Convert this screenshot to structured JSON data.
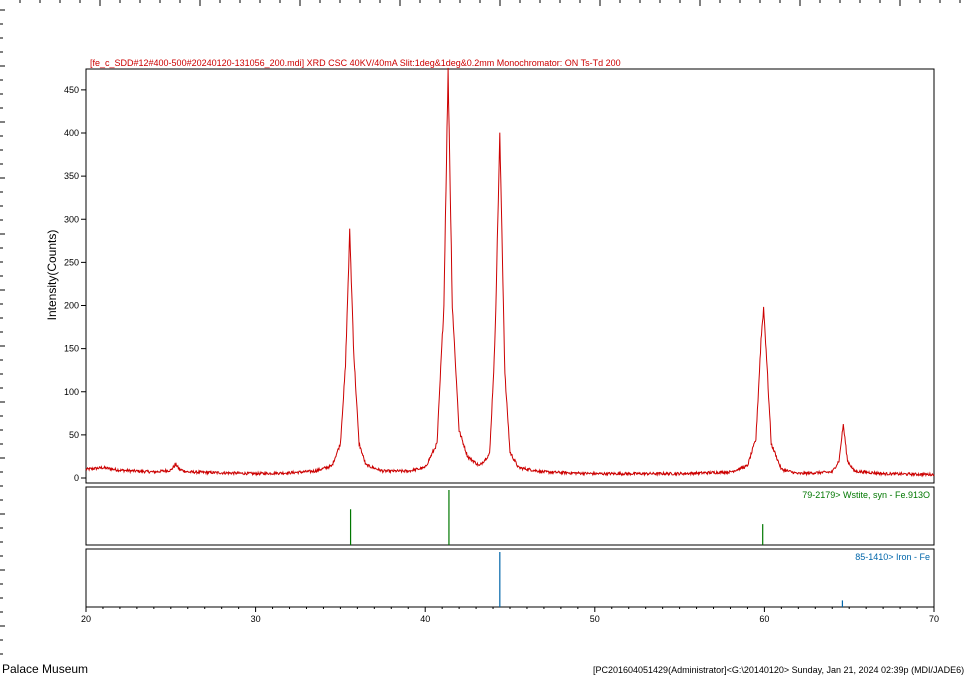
{
  "chart_data": {
    "type": "line",
    "title": "[fe_c_SDD#12#400-500#20240120-131056_200.mdi] XRD CSC 40KV/40mA Slit:1deg&1deg&0.2mm Monochromator: ON Ts-Td 200",
    "xlabel": "",
    "ylabel": "Intensity(Counts)",
    "xlim": [
      20,
      70
    ],
    "ylim": [
      0,
      480
    ],
    "x_ticks": [
      20,
      30,
      40,
      50,
      60,
      70
    ],
    "y_ticks": [
      0,
      50,
      100,
      150,
      200,
      250,
      300,
      350,
      400,
      450
    ],
    "grid": false,
    "colors": {
      "pattern": "#cc0000",
      "wustite": "#007700",
      "iron": "#0066aa"
    },
    "series": [
      {
        "x": [
          20.0,
          21.0,
          22.0,
          23.0,
          24.0,
          25.0,
          25.3,
          25.5,
          26.0,
          28.0,
          30.0,
          32.0,
          33.5,
          34.5,
          35.0,
          35.3,
          35.55,
          35.8,
          36.1,
          36.5,
          37.5,
          39.0,
          40.0,
          40.7,
          41.1,
          41.35,
          41.6,
          42.0,
          42.5,
          43.2,
          43.8,
          44.1,
          44.4,
          44.7,
          45.0,
          45.5,
          47.0,
          50.0,
          55.0,
          58.0,
          59.0,
          59.5,
          59.8,
          59.95,
          60.1,
          60.4,
          61.0,
          62.0,
          64.0,
          64.4,
          64.65,
          64.9,
          65.3,
          67.0,
          70.0
        ],
        "y": [
          10,
          12,
          9,
          8,
          7,
          9,
          16,
          10,
          7,
          6,
          5,
          6,
          8,
          14,
          40,
          130,
          285,
          140,
          40,
          15,
          8,
          8,
          12,
          40,
          200,
          472,
          200,
          55,
          25,
          14,
          28,
          150,
          397,
          120,
          30,
          12,
          7,
          5,
          5,
          7,
          14,
          45,
          160,
          197,
          150,
          40,
          10,
          5,
          7,
          20,
          62,
          20,
          8,
          5,
          4
        ]
      }
    ],
    "reference_patterns": [
      {
        "label": "79-2179> Wstite, syn - Fe.913O",
        "lines": [
          {
            "x": 35.6,
            "intensity": 0.65
          },
          {
            "x": 41.4,
            "intensity": 1.0
          },
          {
            "x": 59.9,
            "intensity": 0.38
          }
        ]
      },
      {
        "label": "85-1410> Iron - Fe",
        "lines": [
          {
            "x": 44.4,
            "intensity": 1.0
          },
          {
            "x": 64.6,
            "intensity": 0.12
          }
        ]
      }
    ]
  },
  "footer": {
    "left": "Palace Museum",
    "right": "[PC201604051429(Administrator]<G:\\20140120> Sunday, Jan 21, 2024 02:39p (MDI/JADE6)"
  }
}
